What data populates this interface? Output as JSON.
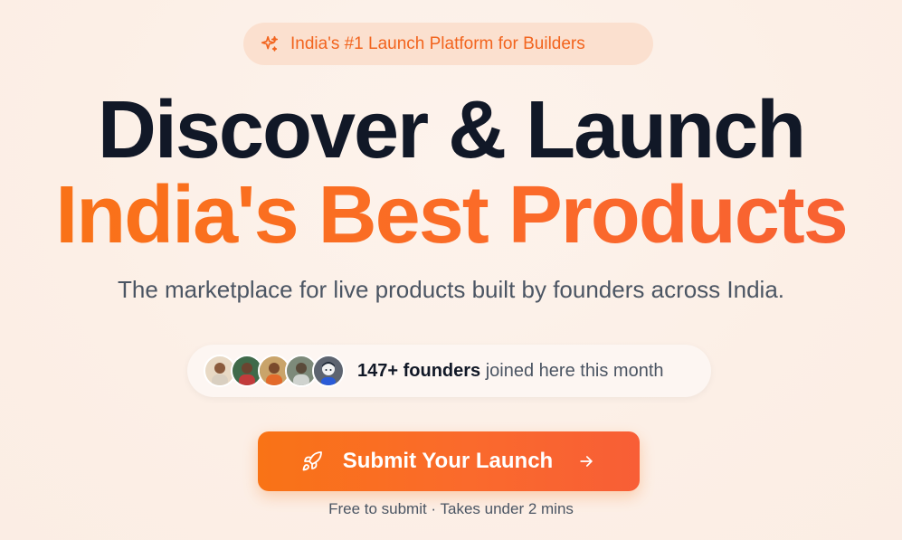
{
  "badge": {
    "icon": "sparkles-icon",
    "text": "India's #1 Launch Platform for Builders",
    "color": "#f2641e"
  },
  "headline": {
    "line1": "Discover & Launch",
    "line2": "India's Best Products"
  },
  "subtitle": "The marketplace for live products built by founders across India.",
  "social_proof": {
    "avatars": [
      "founder-avatar-1",
      "founder-avatar-2",
      "founder-avatar-3",
      "founder-avatar-4",
      "founder-avatar-5"
    ],
    "count": "147+ founders",
    "text": "joined here this month"
  },
  "cta": {
    "label": "Submit Your Launch",
    "left_icon": "rocket-icon",
    "right_icon": "arrow-right-icon"
  },
  "note": "Free to submit · Takes under 2 mins",
  "colors": {
    "accent": "#f97316",
    "headline": "#111827",
    "muted": "#4b5563",
    "background": "#fdf1ea"
  }
}
